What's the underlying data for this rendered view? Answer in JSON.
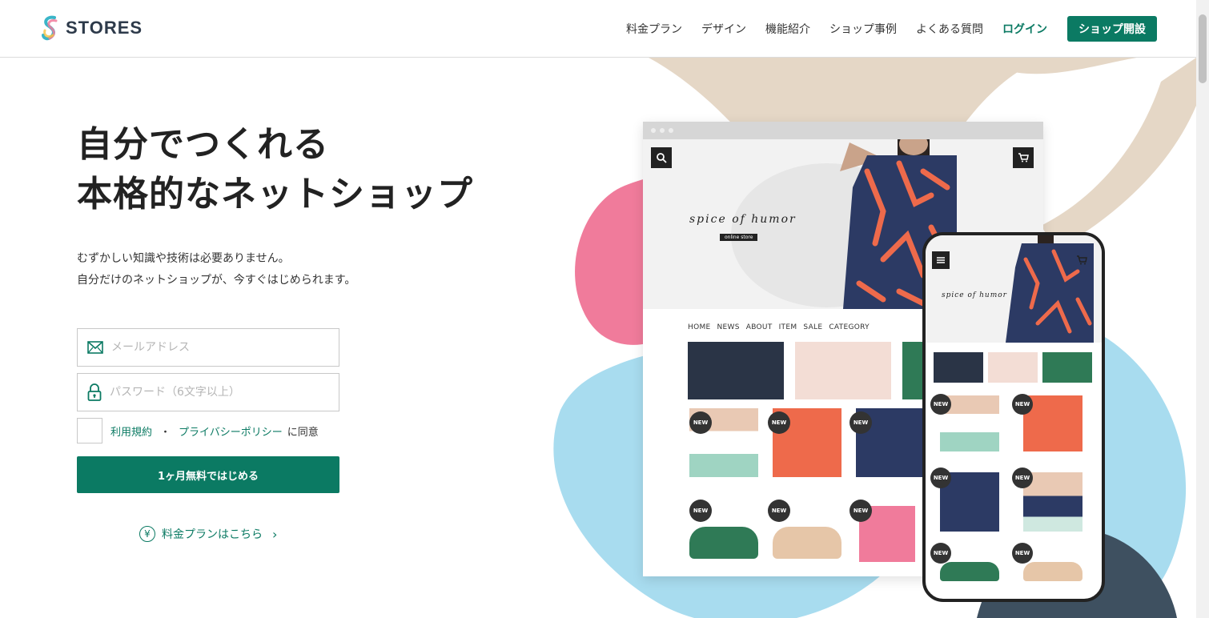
{
  "header": {
    "logo_text": "STORES",
    "nav": [
      "料金プラン",
      "デザイン",
      "機能紹介",
      "ショップ事例",
      "よくある質問"
    ],
    "login": "ログイン",
    "open_shop": "ショップ開設"
  },
  "hero": {
    "title_line1": "自分でつくれる",
    "title_line2": "本格的なネットショップ",
    "sub_line1": "むずかしい知識や技術は必要ありません。",
    "sub_line2": "自分だけのネットショップが、今すぐはじめられます。"
  },
  "form": {
    "email_placeholder": "メールアドレス",
    "password_placeholder": "パスワード（6文字以上）",
    "terms_link": "利用規約",
    "separator": "・",
    "privacy_link": "プライバシーポリシー",
    "agree_text": "に同意",
    "submit": "1ヶ月無料ではじめる",
    "plan_link": "料金プランはこちら",
    "yen_symbol": "¥",
    "chevron": "›"
  },
  "mockup": {
    "brand": "spice of humor",
    "brand_tag": "online store",
    "shop_nav": [
      "HOME",
      "NEWS",
      "ABOUT",
      "ITEM",
      "SALE",
      "CATEGORY"
    ],
    "new_label": "NEW"
  },
  "colors": {
    "accent": "#0b7a63",
    "pink_blob": "#f07b9b",
    "blue_blob": "#a8dcef",
    "beige_stroke": "#e5d7c6",
    "dark_blob": "#3e5060"
  },
  "icons": [
    "mail-icon",
    "lock-icon",
    "yen-icon",
    "chevron-right-icon",
    "search-icon",
    "cart-icon",
    "menu-icon"
  ]
}
